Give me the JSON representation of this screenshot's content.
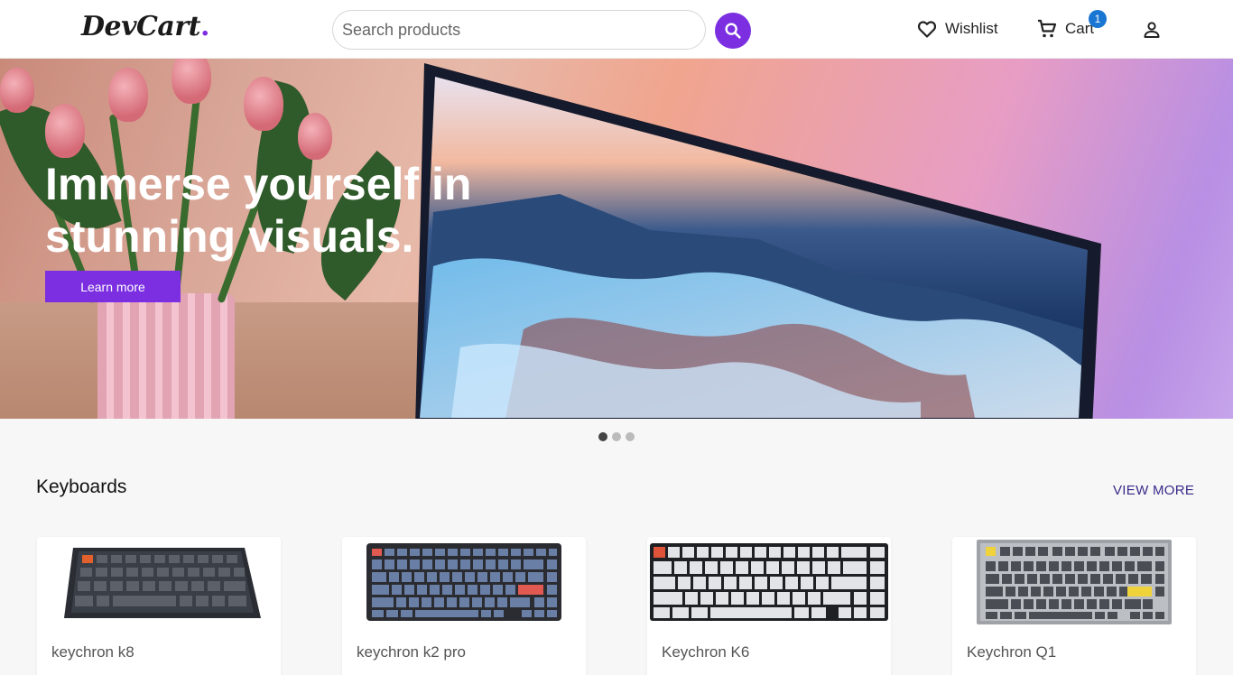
{
  "header": {
    "logo": "DevCart",
    "logo_dot": ".",
    "search_placeholder": "Search products",
    "wishlist_label": "Wishlist",
    "cart_label": "Cart",
    "cart_count": "1",
    "icons": [
      "search-icon",
      "heart-icon",
      "cart-icon",
      "account-icon"
    ]
  },
  "hero": {
    "title": "Immerse yourself in stunning visuals.",
    "button_label": "Learn more",
    "slides": 3,
    "active_slide": 1
  },
  "section": {
    "title": "Keyboards",
    "view_more": "VIEW MORE"
  },
  "products": [
    {
      "name": "keychron k8"
    },
    {
      "name": "keychron k2 pro"
    },
    {
      "name": "Keychron K6"
    },
    {
      "name": "Keychron Q1"
    }
  ],
  "colors": {
    "accent": "#7b2fe0",
    "badge": "#1976d2"
  }
}
